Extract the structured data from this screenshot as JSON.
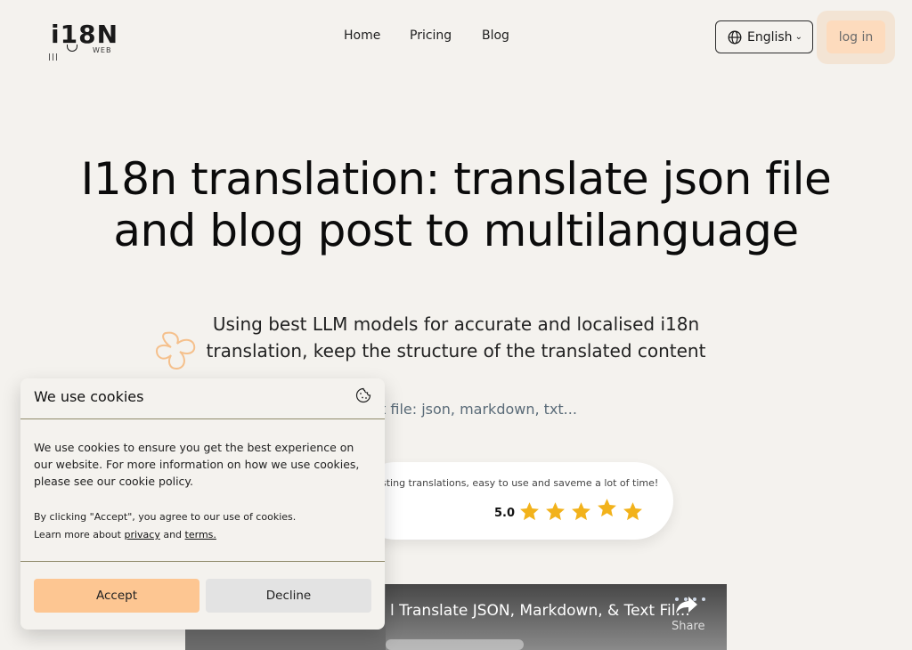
{
  "header": {
    "logo_text": "i18N",
    "logo_sub": "WEB",
    "nav": [
      {
        "label": "Home"
      },
      {
        "label": "Pricing"
      },
      {
        "label": "Blog"
      }
    ],
    "language": {
      "label": "English",
      "icon": "globe-icon"
    },
    "login_label": "log in"
  },
  "hero": {
    "title_line1": "I18n translation: translate json file",
    "title_line2": "and blog post to multilanguage",
    "subtitle_line1": "Using best LLM models for accurate and localised i18n",
    "subtitle_line2": "translation, keep the structure of the translated content",
    "supports_visible": "t file: json, markdown, txt..."
  },
  "review": {
    "text": "sting translations, easy to use and saveme a lot of time!",
    "score": "5.0",
    "stars": 5,
    "star_color": "#f2b21b"
  },
  "video": {
    "title": "l Translate JSON, Markdown, & Text Fil...",
    "share_label": "Share"
  },
  "cookie": {
    "title": "We use cookies",
    "body": "We use cookies to ensure you get the best experience on our website. For more information on how we use cookies, please see our cookie policy.",
    "consent_text": "By clicking \"Accept\", you agree to our use of cookies.",
    "learn_more_prefix": "Learn more about",
    "privacy_link": "privacy",
    "and_text": "and",
    "terms_link": "terms.",
    "accept_label": "Accept",
    "decline_label": "Decline"
  },
  "colors": {
    "background": "#f4f2ee",
    "accent": "#fdc692",
    "login_bg": "#fddbbd",
    "star": "#f2b21b"
  }
}
